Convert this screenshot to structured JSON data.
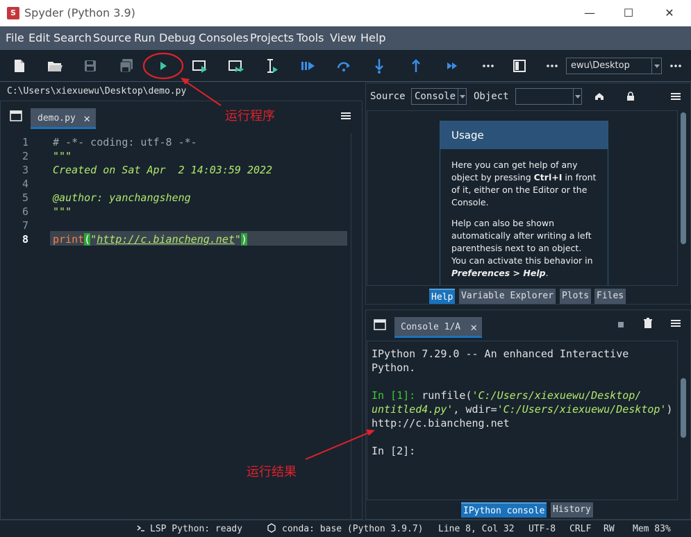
{
  "window": {
    "title": "Spyder (Python 3.9)",
    "logo_text": "S",
    "minimize_glyph": "—",
    "maximize_glyph": "☐",
    "close_glyph": "✕"
  },
  "menu": [
    "File",
    "Edit",
    "Search",
    "Source",
    "Run",
    "Debug",
    "Consoles",
    "Projects",
    "Tools",
    "View",
    "Help"
  ],
  "toolbar": {
    "working_dir": "ewu\\Desktop",
    "more_glyph": "•••"
  },
  "editor": {
    "path": "C:\\Users\\xiexuewu\\Desktop\\demo.py",
    "tab_label": "demo.py",
    "tab_close": "✕",
    "line_numbers": [
      "1",
      "2",
      "3",
      "4",
      "5",
      "6",
      "7",
      "8"
    ],
    "code": {
      "l1": "# -*- coding: utf-8 -*-",
      "l2": "\"\"\"",
      "l3": "Created on Sat Apr  2 14:03:59 2022",
      "l4": "",
      "l5": "@author: yanchangsheng",
      "l6": "\"\"\"",
      "l7": "",
      "l8_func": "print",
      "l8_open": "(",
      "l8_quote1": "\"",
      "l8_url": "http://c.biancheng.net",
      "l8_quote2": "\"",
      "l8_close": ")"
    },
    "current_line": 8
  },
  "help": {
    "source_label": "Source",
    "source_value": "Console",
    "object_label": "Object",
    "object_value": "",
    "usage_title": "Usage",
    "usage_p1_a": "Here you can get help of any object by pressing ",
    "usage_p1_key": "Ctrl+I",
    "usage_p1_b": " in front of it, either on the Editor or the Console.",
    "usage_p2_a": "Help can also be shown automatically after writing a left parenthesis next to an object. You can activate this behavior in ",
    "usage_p2_pref": "Preferences > Help",
    "usage_p2_b": ".",
    "tabs": [
      "Help",
      "Variable Explorer",
      "Plots",
      "Files"
    ]
  },
  "console": {
    "tab_label": "Console 1/A",
    "tab_close": "✕",
    "banner_1": "IPython 7.29.0 -- An enhanced Interactive",
    "banner_2": "Python.",
    "in1_prompt": "In [1]:",
    "in1_cmd_a": " runfile(",
    "in1_str1": "'C:/Users/xiexuewu/Desktop/",
    "in1_str1b": "untitled4.py'",
    "in1_mid": ", wdir=",
    "in1_str2": "'C:/Users/xiexuewu/Desktop'",
    "in1_end": ")",
    "output": "http://c.biancheng.net",
    "in2_prompt": "In [2]:",
    "tabs": [
      "IPython console",
      "History"
    ]
  },
  "statusbar": {
    "lsp": "LSP Python: ready",
    "conda": "conda: base (Python 3.9.7)",
    "position": "Line 8, Col 32",
    "encoding": "UTF-8",
    "eol": "CRLF",
    "rw": "RW",
    "mem": "Mem 83%"
  },
  "annotations": {
    "run_program": "运行程序",
    "run_result": "运行结果"
  },
  "colors": {
    "accent": "#1a72bb",
    "annotation_red": "#e0212a",
    "run_green": "#3fc8a0",
    "string_green": "#b2e86c",
    "keyword_orange": "#f88048"
  }
}
